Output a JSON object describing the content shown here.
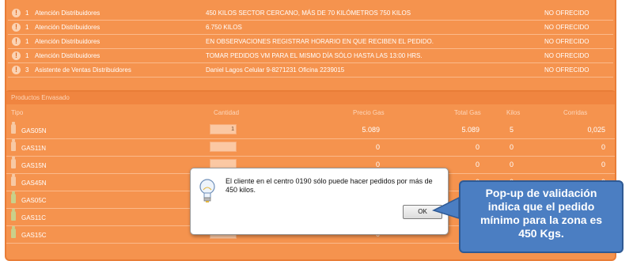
{
  "observaciones": {
    "rows": [
      {
        "count": "1",
        "who": "Atención Distribuidores",
        "message": "450 KILOS SECTOR CERCANO, MÁS DE 70 KILÓMETROS 750 KILOS",
        "status": "NO OFRECIDO"
      },
      {
        "count": "1",
        "who": "Atención Distribuidores",
        "message": "6.750 KILOS",
        "status": "NO OFRECIDO"
      },
      {
        "count": "1",
        "who": "Atención Distribuidores",
        "message": "EN OBSERVACIONES REGISTRAR HORARIO EN QUE RECIBEN EL PEDIDO.",
        "status": "NO OFRECIDO"
      },
      {
        "count": "1",
        "who": "Atención Distribuidores",
        "message": "TOMAR PEDIDOS VM PARA EL MISMO DÍA SÓLO HASTA LAS 13:00 HRS.",
        "status": "NO OFRECIDO"
      },
      {
        "count": "3",
        "who": "Asistente de Ventas Distribuidores",
        "message": "Daniel Lagos Celular 9-8271231 Oficina 2239015",
        "status": "NO OFRECIDO"
      }
    ]
  },
  "productos": {
    "title": "Productos Envasado",
    "headers": {
      "tipo": "Tipo",
      "cantidad": "Cantidad",
      "precio": "Precio Gas",
      "total": "Total Gas",
      "kilos": "Kilos",
      "corridas": "Corridas"
    },
    "rows": [
      {
        "code": "GAS05N",
        "qty": "1",
        "precio": "5.089",
        "total": "5.089",
        "kilos": "5",
        "corridas": "0,025"
      },
      {
        "code": "GAS11N",
        "qty": "",
        "precio": "0",
        "total": "0",
        "kilos": "0",
        "corridas": "0"
      },
      {
        "code": "GAS15N",
        "qty": "",
        "precio": "0",
        "total": "0",
        "kilos": "0",
        "corridas": "0"
      },
      {
        "code": "GAS45N",
        "qty": "",
        "precio": "",
        "total": "0",
        "kilos": "0",
        "corridas": "0"
      },
      {
        "code": "GAS05C",
        "qty": "",
        "precio": "",
        "total": "",
        "kilos": "",
        "corridas": ""
      },
      {
        "code": "GAS11C",
        "qty": "",
        "precio": "",
        "total": "",
        "kilos": "",
        "corridas": ""
      },
      {
        "code": "GAS15C",
        "qty": "",
        "precio": "0",
        "total": "",
        "kilos": "",
        "corridas": ""
      }
    ]
  },
  "dialog": {
    "message": "El cliente en el centro 0190 sólo puede hacer pedidos por más de 450 kilos.",
    "ok_label": "OK"
  },
  "callout": {
    "line1": "Pop-up de validación",
    "line2": "indica que el pedido",
    "line3": "mínimo para la zona es",
    "line4": "450 Kgs."
  },
  "colors": {
    "panel": "#f5934e",
    "callout": "#4b7ec2"
  }
}
